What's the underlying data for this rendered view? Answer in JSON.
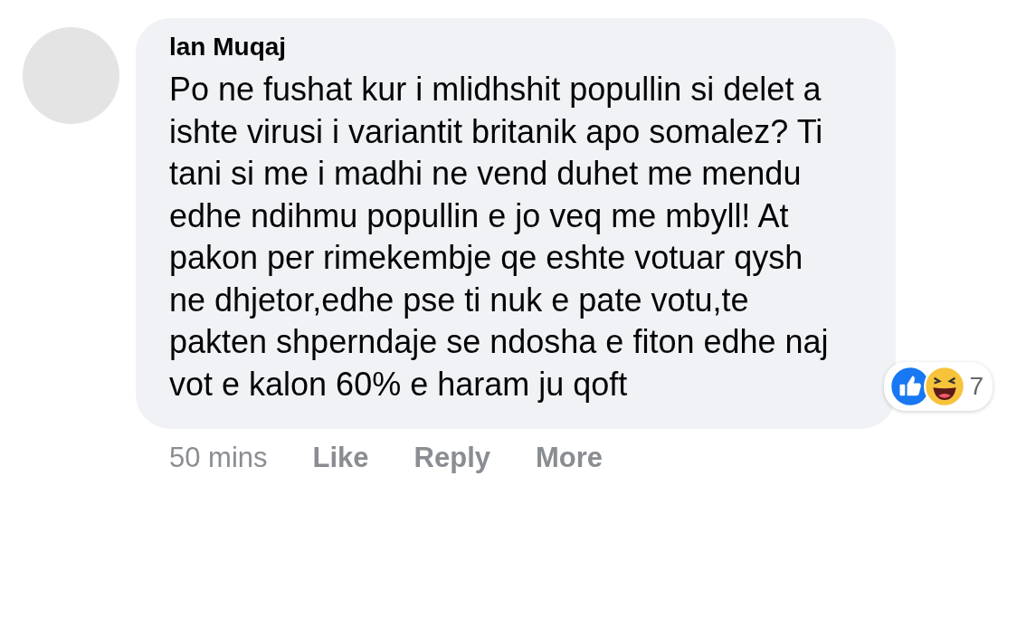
{
  "comment": {
    "author": "lan Muqaj",
    "text": "Po ne fushat kur i mlidhshit popullin si delet a ishte virusi i variantit britanik apo somalez? Ti tani si me i madhi ne vend duhet me mendu edhe ndihmu popullin e jo veq me mbyll! At pakon per rimekembje qe eshte votuar qysh ne dhjetor,edhe pse ti nuk e pate votu,te pakten shperndaje se ndosha e fiton edhe naj vot e kalon 60% e haram ju qoft",
    "reactions": {
      "items": [
        {
          "kind": "like"
        },
        {
          "kind": "haha"
        }
      ],
      "count": "7"
    },
    "time": "50 mins",
    "actions": [
      "Like",
      "Reply",
      "More"
    ]
  }
}
